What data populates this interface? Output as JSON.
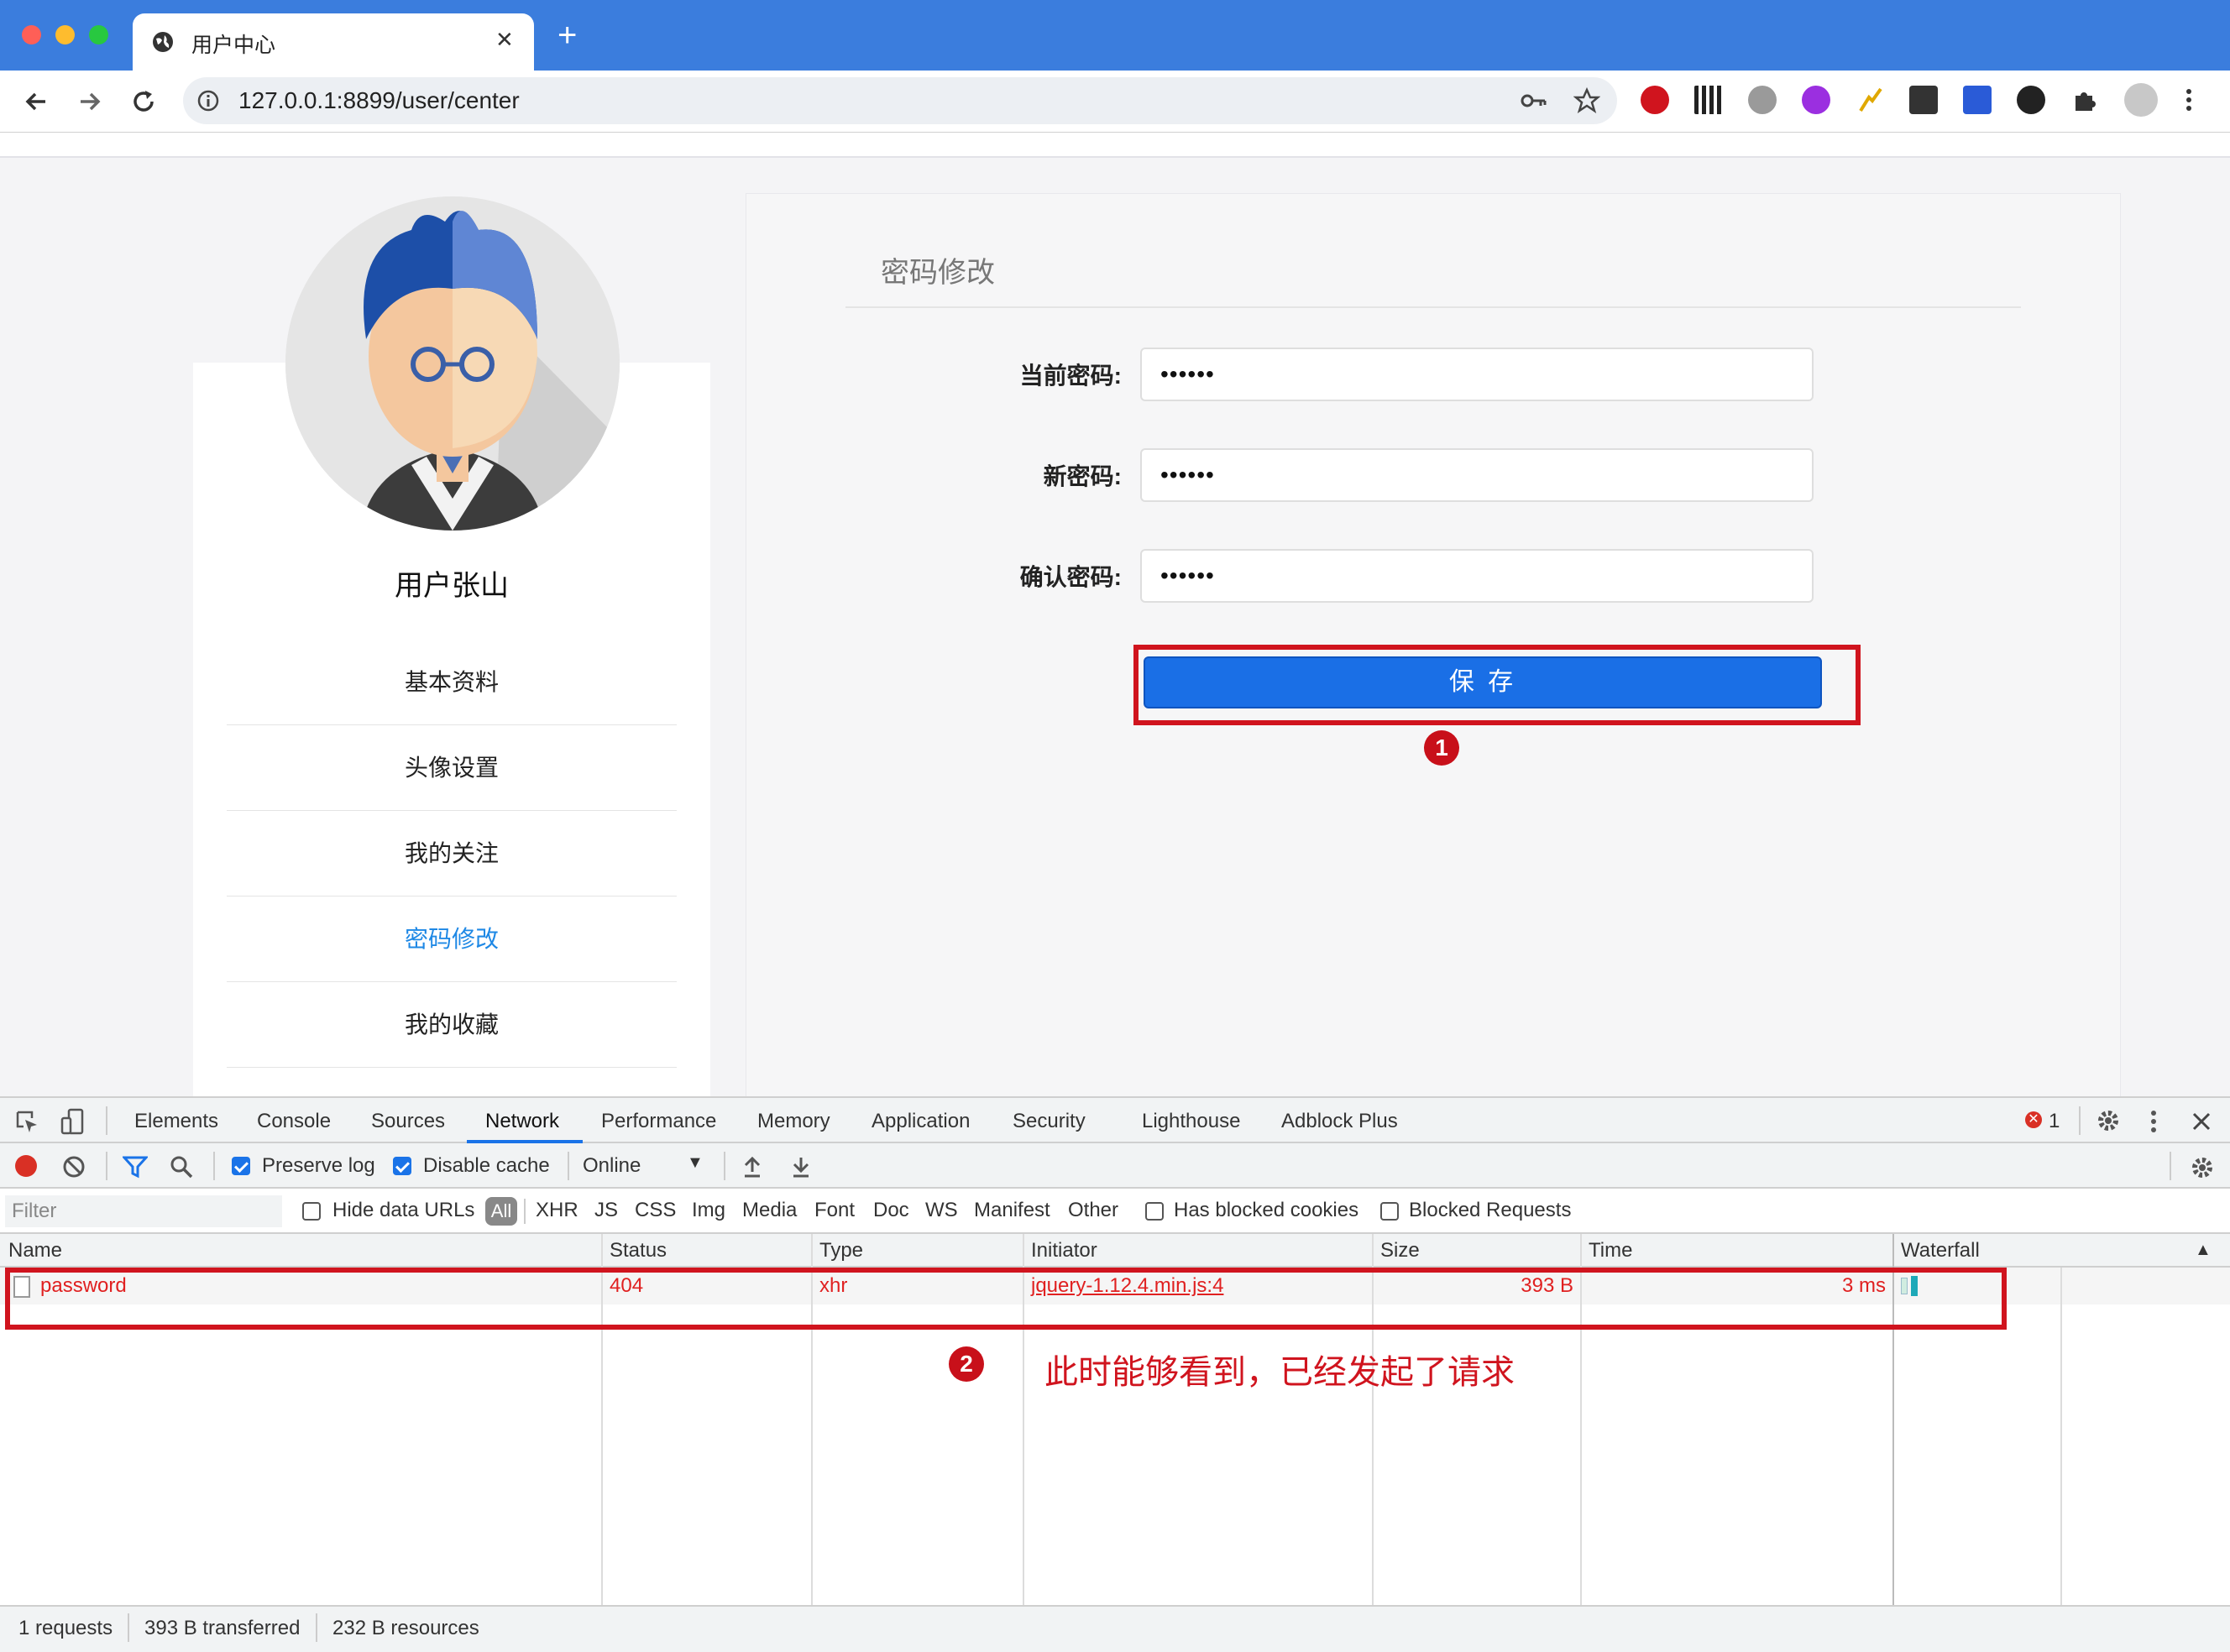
{
  "browser": {
    "tab_title": "用户中心",
    "tab_close": "✕",
    "new_tab": "+",
    "url": "127.0.0.1:8899/user/center"
  },
  "sidebar": {
    "username": "用户张山",
    "items": [
      {
        "label": "基本资料",
        "active": false
      },
      {
        "label": "头像设置",
        "active": false
      },
      {
        "label": "我的关注",
        "active": false
      },
      {
        "label": "密码修改",
        "active": true
      },
      {
        "label": "我的收藏",
        "active": false
      }
    ],
    "active_color": "#1e88e5"
  },
  "form": {
    "title": "密码修改",
    "fields": [
      {
        "label": "当前密码:",
        "value": "••••••"
      },
      {
        "label": "新密码:",
        "value": "••••••"
      },
      {
        "label": "确认密码:",
        "value": "••••••"
      }
    ],
    "save_label": "保 存",
    "save_color": "#1a6fe6"
  },
  "devtools": {
    "tabs": [
      "Elements",
      "Console",
      "Sources",
      "Network",
      "Performance",
      "Memory",
      "Application",
      "Security",
      "Lighthouse",
      "Adblock Plus"
    ],
    "active_tab": "Network",
    "error_count": "1",
    "preserve_log": "Preserve log",
    "disable_cache": "Disable cache",
    "throttle": "Online",
    "filter_placeholder": "Filter",
    "hide_data_urls": "Hide data URLs",
    "type_filters": [
      "All",
      "XHR",
      "JS",
      "CSS",
      "Img",
      "Media",
      "Font",
      "Doc",
      "WS",
      "Manifest",
      "Other"
    ],
    "has_blocked_cookies": "Has blocked cookies",
    "blocked_requests": "Blocked Requests",
    "columns": [
      "Name",
      "Status",
      "Type",
      "Initiator",
      "Size",
      "Time",
      "Waterfall"
    ],
    "rows": [
      {
        "name": "password",
        "status": "404",
        "type": "xhr",
        "initiator": "jquery-1.12.4.min.js:4",
        "size": "393 B",
        "time": "3 ms"
      }
    ],
    "summary": {
      "requests": "1 requests",
      "transferred": "393 B transferred",
      "resources": "232 B resources"
    }
  },
  "annotations": {
    "badge1": "1",
    "badge2": "2",
    "note": "此时能够看到，已经发起了请求",
    "color": "#d0141e"
  }
}
